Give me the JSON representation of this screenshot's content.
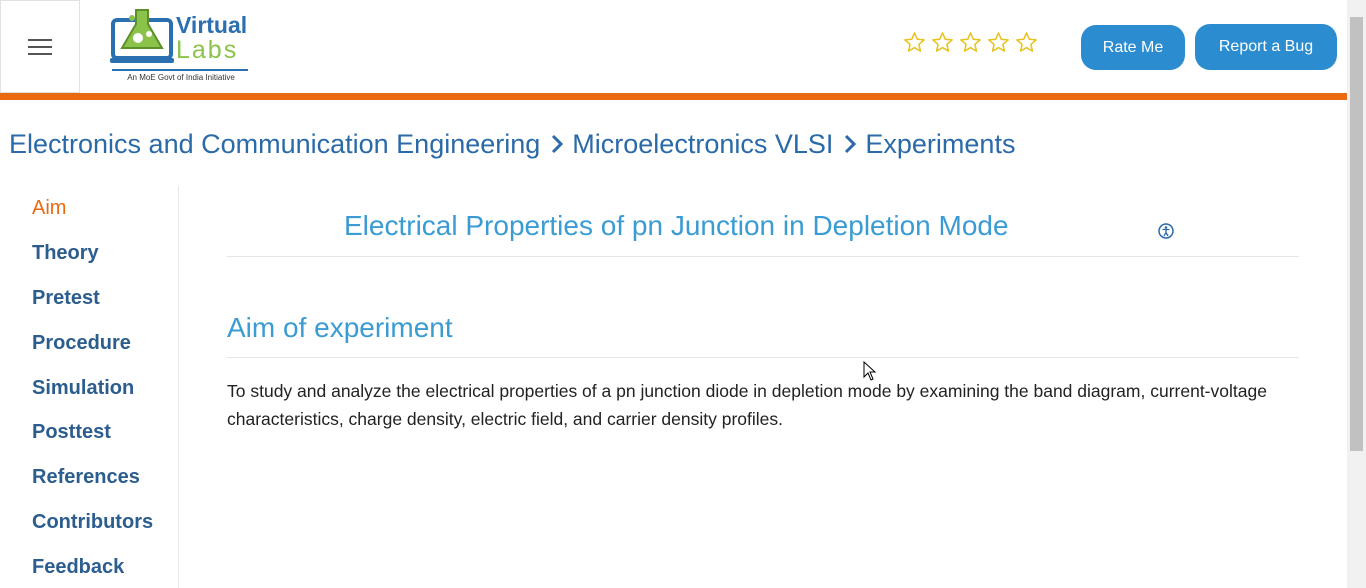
{
  "header": {
    "logo": {
      "line1": "Virtual",
      "line2": "Labs",
      "caption": "An MoE Govt of India Initiative"
    },
    "rating_stars": 5,
    "rate_button": "Rate Me",
    "bug_button": "Report a Bug",
    "colors": {
      "accent_bar": "#e96a10",
      "button": "#2b8cd0",
      "star": "#e8c21d"
    }
  },
  "breadcrumb": {
    "items": [
      "Electronics and Communication Engineering",
      "Microelectronics VLSI",
      "Experiments"
    ]
  },
  "sidebar": {
    "items": [
      {
        "label": "Aim",
        "active": true
      },
      {
        "label": "Theory",
        "active": false
      },
      {
        "label": "Pretest",
        "active": false
      },
      {
        "label": "Procedure",
        "active": false
      },
      {
        "label": "Simulation",
        "active": false
      },
      {
        "label": "Posttest",
        "active": false
      },
      {
        "label": "References",
        "active": false
      },
      {
        "label": "Contributors",
        "active": false
      },
      {
        "label": "Feedback",
        "active": false
      }
    ]
  },
  "main": {
    "experiment_title": "Electrical Properties of pn Junction in Depletion Mode",
    "section_title": "Aim of experiment",
    "aim_text": "To study and analyze the electrical properties of a pn junction diode in depletion mode by examining the band diagram, current-voltage characteristics, charge density, electric field, and carrier density profiles."
  }
}
